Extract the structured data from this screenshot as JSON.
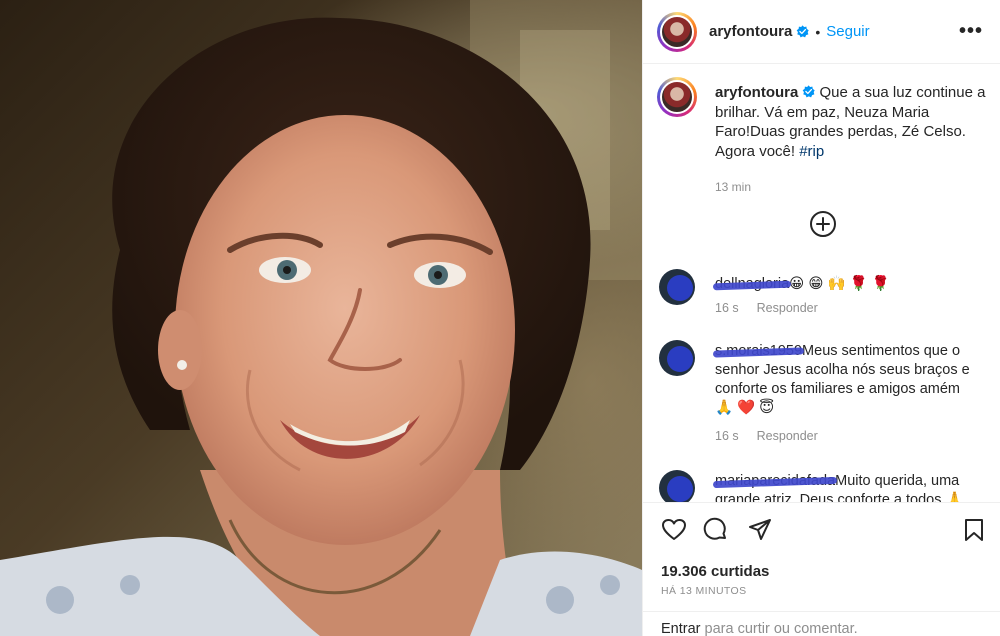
{
  "post": {
    "username": "aryfontoura",
    "follow_label": "Seguir",
    "more_label": "•••",
    "separator": "•"
  },
  "caption": {
    "username": "aryfontoura",
    "text": " Que a sua luz continue a brilhar. Vá em paz, Neuza Maria Faro!Duas grandes perdas, Zé Celso. Agora você! ",
    "hashtag": "#rip",
    "time": "13 min"
  },
  "comments": [
    {
      "username": "dellnagloria",
      "text": "😀 😁 🙌 🌹 🌹",
      "time": "16 s",
      "reply_label": "Responder"
    },
    {
      "username": "s.morais1959",
      "text": "Meus sentimentos que o senhor Jesus acolha nós seus braços e conforte os familiares e amigos amém 🙏 ❤️ 😇",
      "time": "16 s",
      "reply_label": "Responder"
    },
    {
      "username": "mariaparecidafada",
      "text": "Muito querida, uma grande atriz. Deus conforte a todos 🙏"
    }
  ],
  "actions": {
    "likes": "19.306 curtidas",
    "ago": "HÁ 13 MINUTOS"
  },
  "login": {
    "link": "Entrar",
    "text": " para curtir ou comentar."
  },
  "colors": {
    "link_blue": "#0095f6",
    "hashtag_blue": "#00376b",
    "muted_gray": "#8e8e8e",
    "redact_blue": "#3f48cc"
  }
}
